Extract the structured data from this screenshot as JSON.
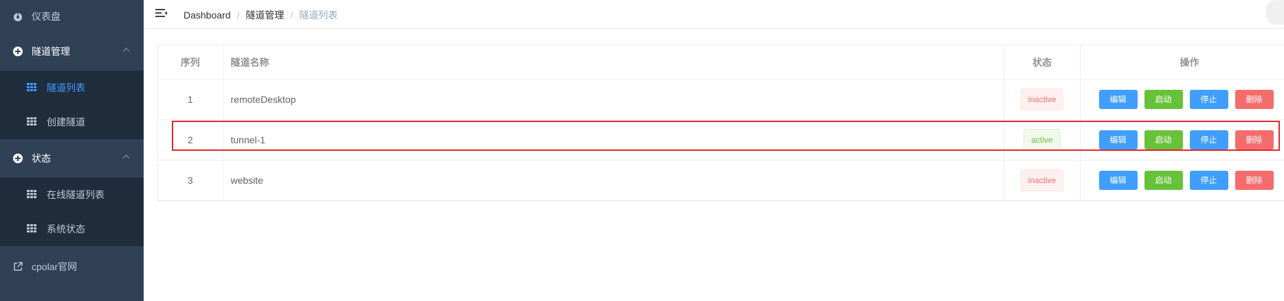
{
  "sidebar": {
    "dashboard": {
      "label": "仪表盘",
      "icon": "dashboard-icon"
    },
    "tunnels": {
      "label": "隧道管理",
      "icon": "plus-circle-icon"
    },
    "tunnel_list": {
      "label": "隧道列表",
      "icon": "grid-icon"
    },
    "create_tunnel": {
      "label": "创建隧道",
      "icon": "grid-icon"
    },
    "status": {
      "label": "状态",
      "icon": "plus-circle-icon"
    },
    "online_tunnels": {
      "label": "在线隧道列表",
      "icon": "grid-icon"
    },
    "system_status": {
      "label": "系统状态",
      "icon": "grid-icon"
    },
    "official_site": {
      "label": "cpolar官网",
      "icon": "external-link-icon"
    }
  },
  "breadcrumb": [
    "Dashboard",
    "隧道管理",
    "隧道列表"
  ],
  "table": {
    "headers": {
      "index": "序列",
      "name": "隧道名称",
      "status": "状态",
      "actions": "操作"
    },
    "rows": [
      {
        "index": "1",
        "name": "remoteDesktop",
        "status": "inactive"
      },
      {
        "index": "2",
        "name": "tunnel-1",
        "status": "active"
      },
      {
        "index": "3",
        "name": "website",
        "status": "inactive"
      }
    ],
    "buttons": {
      "edit": "编辑",
      "start": "启动",
      "stop": "停止",
      "delete": "删除"
    }
  },
  "colors": {
    "sidebar_bg": "#304156",
    "submenu_bg": "#1f2d3d",
    "primary": "#409eff",
    "success": "#67c23a",
    "danger": "#f56c6c",
    "highlight": "#e5252a"
  }
}
